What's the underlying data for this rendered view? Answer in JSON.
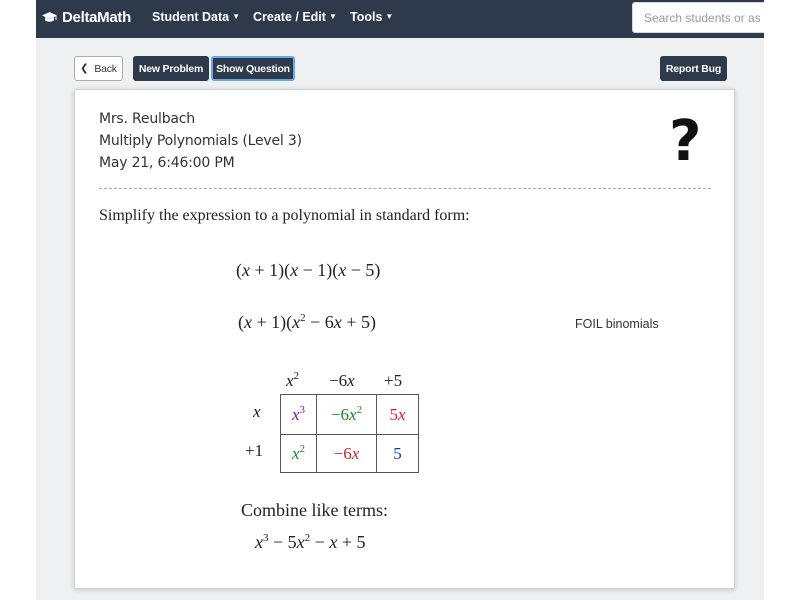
{
  "topbar": {
    "brand": "DeltaMath",
    "nav": [
      {
        "label": "Student Data"
      },
      {
        "label": "Create / Edit"
      },
      {
        "label": "Tools"
      }
    ],
    "search_placeholder": "Search students or assig"
  },
  "toolbar": {
    "back_label": "Back",
    "new_problem_label": "New Problem",
    "show_question_label": "Show Question",
    "report_bug_label": "Report Bug"
  },
  "problem": {
    "teacher": "Mrs. Reulbach",
    "skill": "Multiply Polynomials (Level 3)",
    "date": "May 21, 6:46:00 PM",
    "help_icon_glyph": "?",
    "instructions": "Simplify the expression to a polynomial in standard form:",
    "foil_note": "FOIL binomials",
    "combine_label": "Combine like terms:"
  },
  "box_table": {
    "col_headers": [
      "x²",
      "−6x",
      "+5"
    ],
    "row_headers": [
      "x",
      "+1"
    ],
    "cells": [
      [
        "x³",
        "−6x²",
        "5x"
      ],
      [
        "x²",
        "−6x",
        "5"
      ]
    ]
  },
  "colors": {
    "topbar": "#2e3a4b",
    "purple": "#8a1c8f",
    "green": "#1f8a2c",
    "red": "#d8242a",
    "blue": "#1533c4",
    "show_question_border": "#6aa9e0"
  }
}
